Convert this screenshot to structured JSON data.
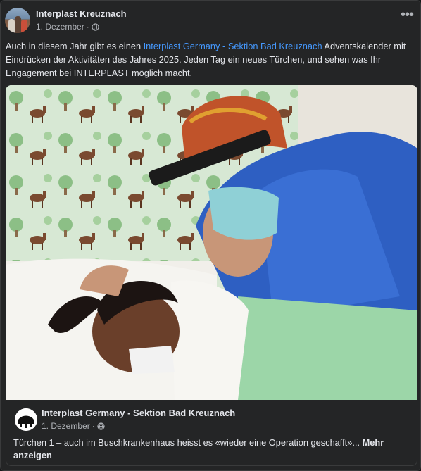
{
  "post": {
    "author": "Interplast Kreuznach",
    "date": "1. Dezember",
    "separator": "·",
    "privacy_icon": "globe-icon",
    "more_icon": "more-options-icon",
    "more_label": "•••",
    "text_before": "Auch in diesem Jahr gibt es einen ",
    "mention": "Interplast Germany - Sektion Bad Kreuznach",
    "text_after": " Adventskalender mit Eindrücken der Aktivitäten des Jahres 2025. Jeden Tag ein neues Türchen, und sehen was Ihr Engagement bei INTERPLAST möglich macht."
  },
  "shared": {
    "author": "Interplast Germany - Sektion Bad Kreuznach",
    "date": "1. Dezember",
    "separator": "·",
    "privacy_icon": "globe-icon",
    "text": "Türchen 1 – auch im Buschkrankenhaus heisst es «wieder eine Operation geschafft»...",
    "more_link": "Mehr anzeigen"
  },
  "colors": {
    "background": "#18191a",
    "card": "#242526",
    "text": "#e4e6eb",
    "secondary_text": "#b0b3b8",
    "link": "#4599ff"
  }
}
